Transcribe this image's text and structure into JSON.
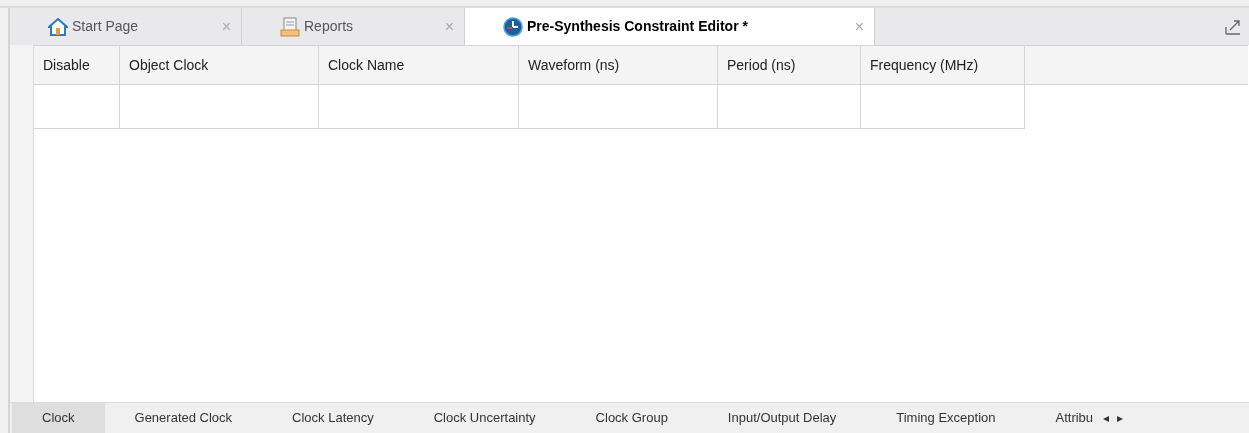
{
  "doc_tabs": [
    {
      "label": "Start Page",
      "kind": "home",
      "selected": false,
      "close": "×"
    },
    {
      "label": "Reports",
      "kind": "report",
      "selected": false,
      "close": "×"
    },
    {
      "label": "Pre-Synthesis Constraint Editor *",
      "kind": "clock",
      "selected": true,
      "close": "×"
    }
  ],
  "table": {
    "columns": [
      "Disable",
      "Object Clock",
      "Clock Name",
      "Waveform (ns)",
      "Period (ns)",
      "Frequency (MHz)"
    ]
  },
  "bottom_tabs": [
    {
      "label": "Clock",
      "selected": true
    },
    {
      "label": "Generated Clock",
      "selected": false
    },
    {
      "label": "Clock Latency",
      "selected": false
    },
    {
      "label": "Clock Uncertainty",
      "selected": false
    },
    {
      "label": "Clock Group",
      "selected": false
    },
    {
      "label": "Input/Output Delay",
      "selected": false
    },
    {
      "label": "Timing Exception",
      "selected": false
    },
    {
      "label": "Attribu",
      "selected": false
    }
  ],
  "scroll_arrows": [
    "◂",
    "▸"
  ]
}
